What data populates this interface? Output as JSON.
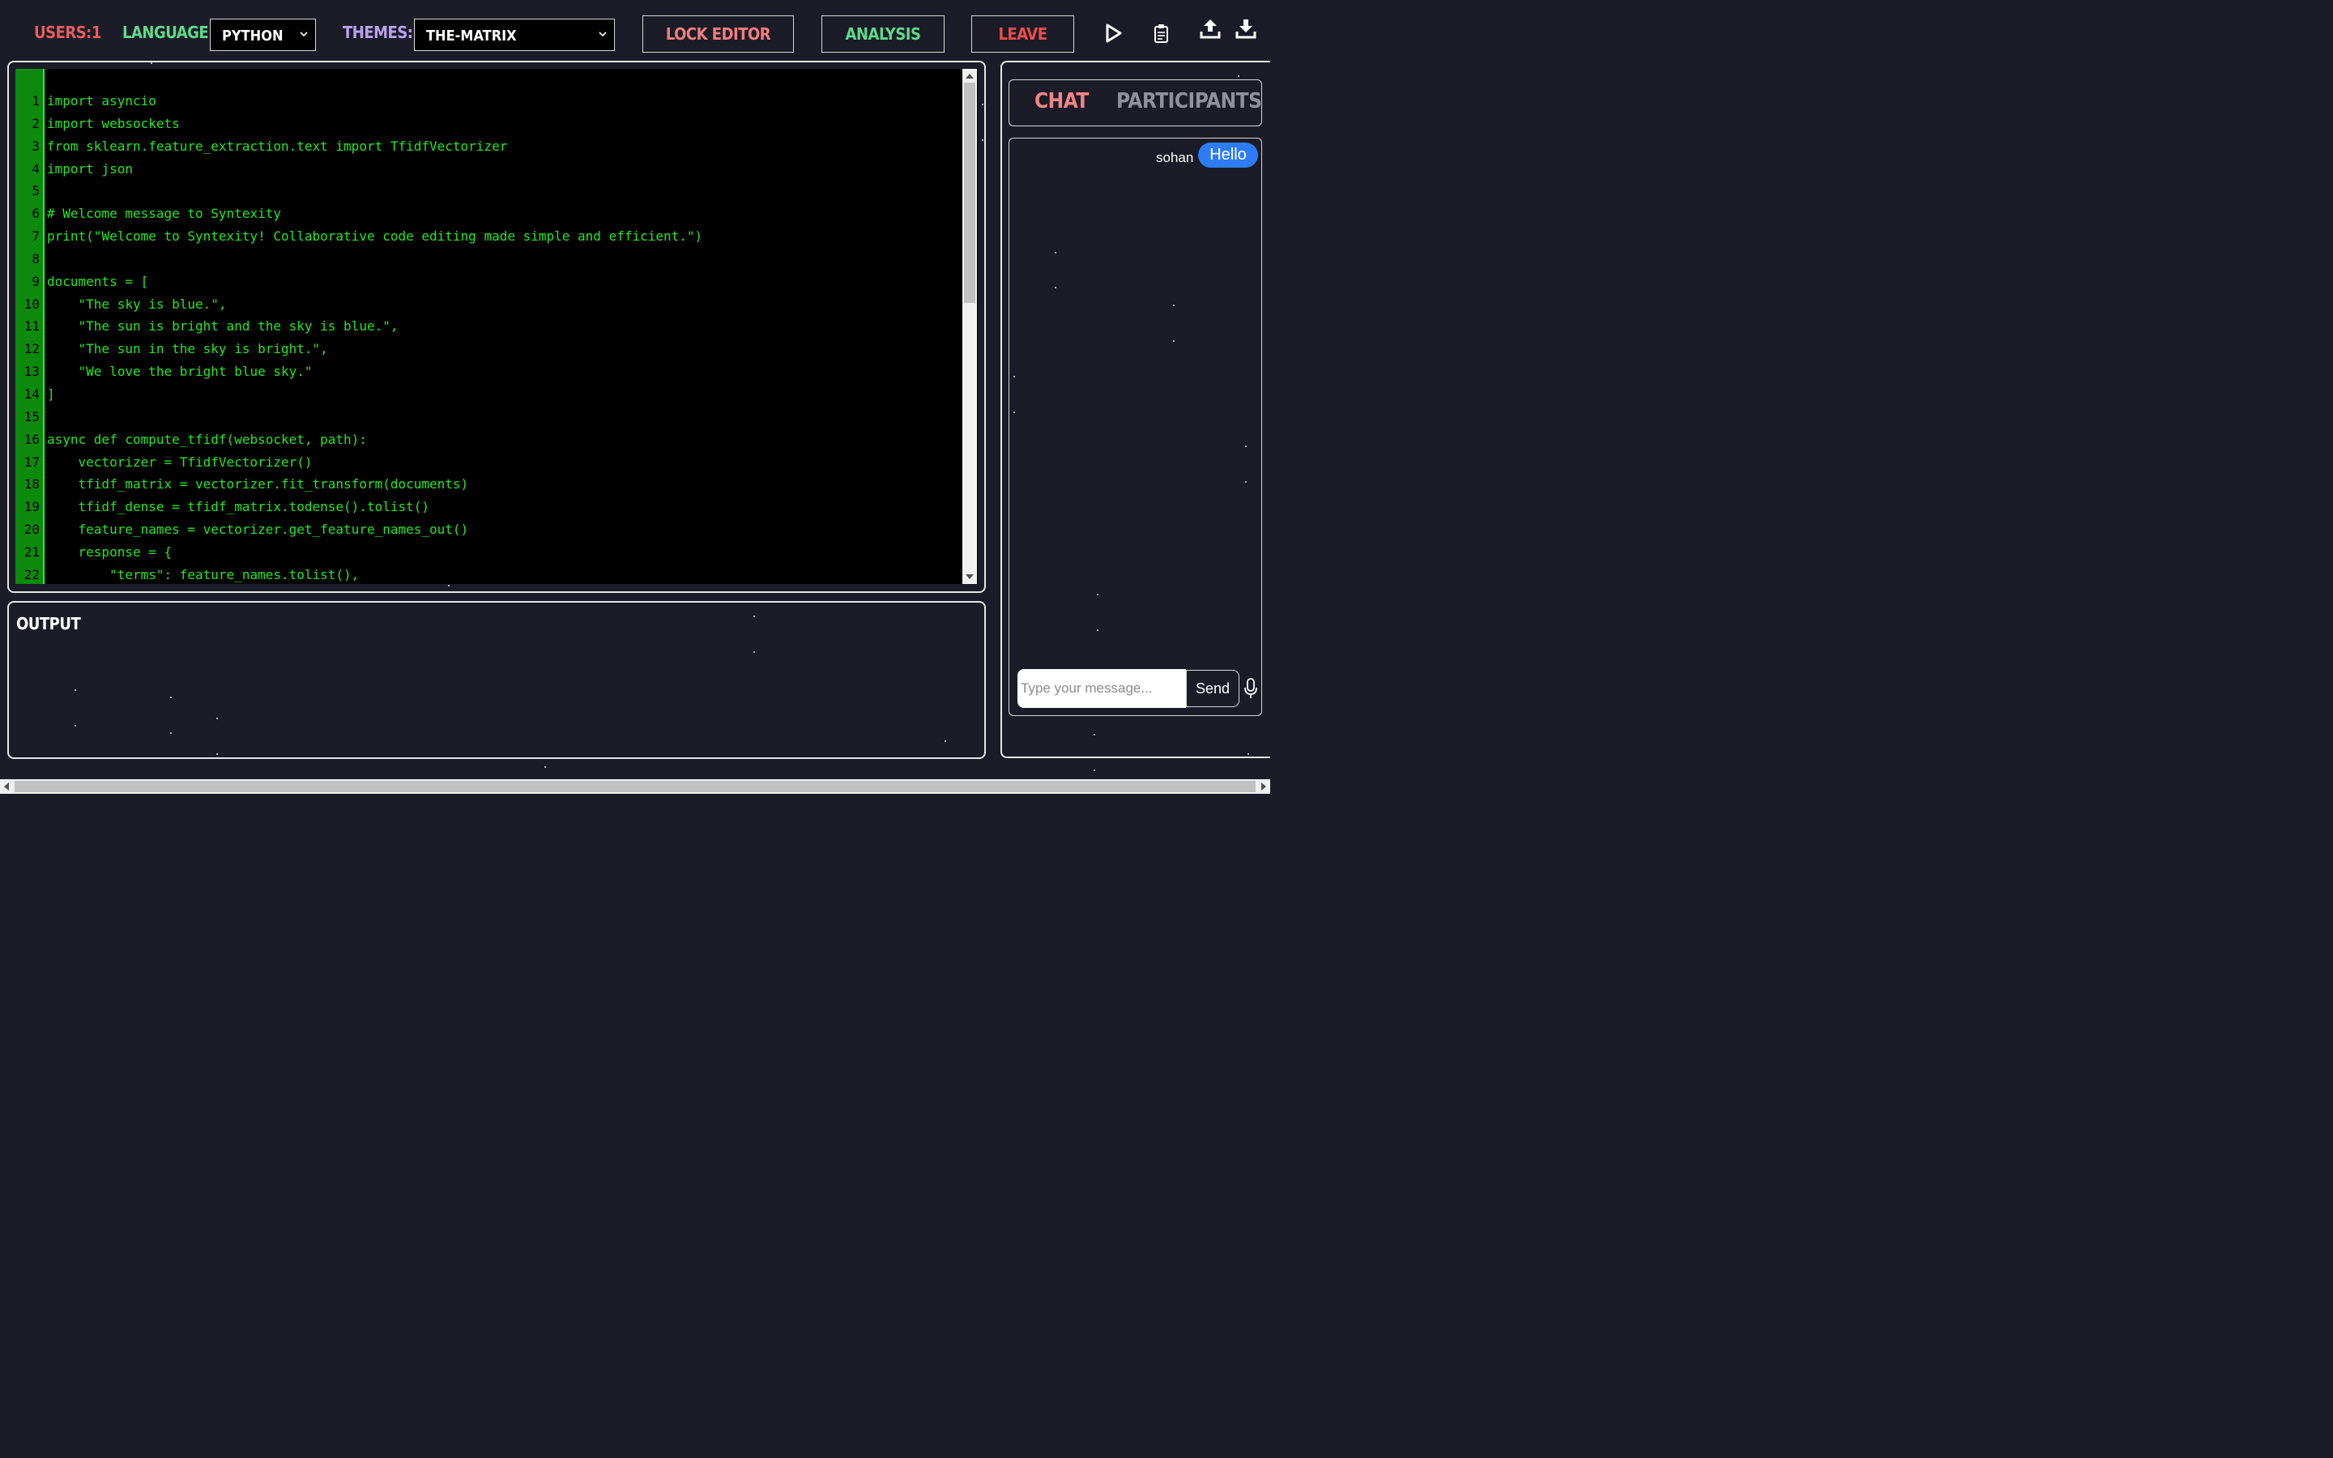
{
  "topbar": {
    "users_label": "USERS:1",
    "language_label": "LANGUAGE:",
    "language_value": "PYTHON",
    "themes_label": "THEMES:",
    "theme_value": "THE-MATRIX",
    "lock_label": "LOCK EDITOR",
    "analysis_label": "ANALYSIS",
    "leave_label": "LEAVE"
  },
  "icons": {
    "run": "play-icon",
    "copy": "clipboard-icon",
    "upload": "upload-icon",
    "download": "download-icon",
    "mic": "microphone-icon"
  },
  "editor": {
    "lines": [
      {
        "n": "1",
        "t": "import asyncio"
      },
      {
        "n": "2",
        "t": "import websockets"
      },
      {
        "n": "3",
        "t": "from sklearn.feature_extraction.text import TfidfVectorizer"
      },
      {
        "n": "4",
        "t": "import json"
      },
      {
        "n": "5",
        "t": ""
      },
      {
        "n": "6",
        "t": "# Welcome message to Syntexity"
      },
      {
        "n": "7",
        "t": "print(\"Welcome to Syntexity! Collaborative code editing made simple and efficient.\")"
      },
      {
        "n": "8",
        "t": ""
      },
      {
        "n": "9",
        "t": "documents = ["
      },
      {
        "n": "10",
        "t": "    \"The sky is blue.\","
      },
      {
        "n": "11",
        "t": "    \"The sun is bright and the sky is blue.\","
      },
      {
        "n": "12",
        "t": "    \"The sun in the sky is bright.\","
      },
      {
        "n": "13",
        "t": "    \"We love the bright blue sky.\""
      },
      {
        "n": "14",
        "t": "]"
      },
      {
        "n": "15",
        "t": ""
      },
      {
        "n": "16",
        "t": "async def compute_tfidf(websocket, path):"
      },
      {
        "n": "17",
        "t": "    vectorizer = TfidfVectorizer()"
      },
      {
        "n": "18",
        "t": "    tfidf_matrix = vectorizer.fit_transform(documents)"
      },
      {
        "n": "19",
        "t": "    tfidf_dense = tfidf_matrix.todense().tolist()"
      },
      {
        "n": "20",
        "t": "    feature_names = vectorizer.get_feature_names_out()"
      },
      {
        "n": "21",
        "t": "    response = {"
      },
      {
        "n": "22",
        "t": "        \"terms\": feature_names.tolist(),"
      }
    ]
  },
  "output": {
    "title": "OUTPUT"
  },
  "sidebar": {
    "tab_chat": "CHAT",
    "tab_participants": "PARTICIPANTS",
    "messages": [
      {
        "sender": "sohan",
        "text": "Hello"
      }
    ],
    "input_placeholder": "Type your message...",
    "send_label": "Send"
  },
  "colors": {
    "background": "#1b1c28",
    "editor_bg": "#000000",
    "code_text": "#22e822",
    "gutter": "#0b8a0b",
    "users": "#e85d5d",
    "language": "#5fd98b",
    "themes": "#b9a3f0",
    "lock": "#f27e7e",
    "analysis": "#5fd98b",
    "leave": "#ee4c4c",
    "bubble": "#2d7cf6"
  }
}
